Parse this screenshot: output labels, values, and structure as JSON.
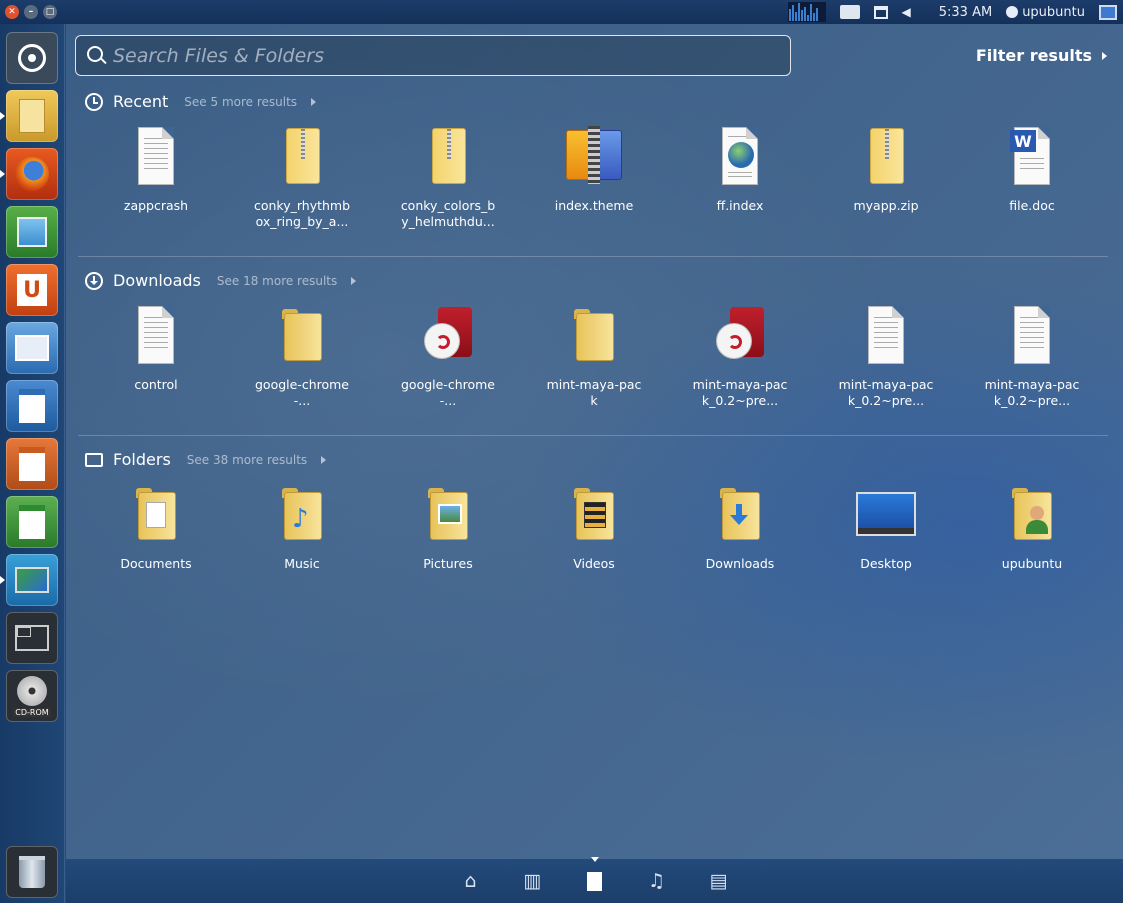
{
  "top_panel": {
    "time": "5:33 AM",
    "user": "upubuntu",
    "window_buttons": [
      "close-icon",
      "minimize-icon",
      "maximize-icon"
    ],
    "indicators": [
      "system-monitor-icon",
      "messaging-icon",
      "network-icon",
      "volume-icon",
      "user-icon",
      "display-icon"
    ]
  },
  "launcher": {
    "items": [
      {
        "name": "dash-home",
        "icon": "ubuntu-logo-icon"
      },
      {
        "name": "files",
        "icon": "folder-icon"
      },
      {
        "name": "firefox",
        "icon": "firefox-icon"
      },
      {
        "name": "shotwell",
        "icon": "photo-icon"
      },
      {
        "name": "ubuntu-software-center",
        "icon": "software-center-icon"
      },
      {
        "name": "system-settings",
        "icon": "settings-icon"
      },
      {
        "name": "libreoffice-writer",
        "icon": "writer-icon"
      },
      {
        "name": "libreoffice-impress",
        "icon": "impress-icon"
      },
      {
        "name": "libreoffice-calc",
        "icon": "calc-icon"
      },
      {
        "name": "remote-desktop",
        "icon": "remote-desktop-icon"
      },
      {
        "name": "workspace-switcher",
        "icon": "workspace-icon"
      },
      {
        "name": "cd-rom",
        "icon": "cd-rom-icon",
        "label": "CD-ROM"
      },
      {
        "name": "trash",
        "icon": "trash-icon"
      }
    ]
  },
  "search": {
    "placeholder": "Search Files & Folders",
    "value": ""
  },
  "filter": {
    "label": "Filter results"
  },
  "sections": {
    "recent": {
      "title": "Recent",
      "more": "See 5 more results",
      "items": [
        {
          "label": "zappcrash",
          "icon": "text-file-icon"
        },
        {
          "label": "conky_rhythmbox_ring_by_a...",
          "icon": "zip-archive-icon"
        },
        {
          "label": "conky_colors_by_helmuthdu...",
          "icon": "zip-archive-icon"
        },
        {
          "label": "index.theme",
          "icon": "theme-file-icon"
        },
        {
          "label": "ff.index",
          "icon": "web-document-icon"
        },
        {
          "label": "myapp.zip",
          "icon": "zip-archive-icon"
        },
        {
          "label": "file.doc",
          "icon": "word-document-icon"
        }
      ]
    },
    "downloads": {
      "title": "Downloads",
      "more": "See 18 more results",
      "items": [
        {
          "label": "control",
          "icon": "text-file-icon"
        },
        {
          "label": "google-chrome-...",
          "icon": "folder-icon"
        },
        {
          "label": "google-chrome-...",
          "icon": "debian-package-icon"
        },
        {
          "label": "mint-maya-pack",
          "icon": "folder-icon"
        },
        {
          "label": "mint-maya-pack_0.2~pre...",
          "icon": "debian-package-icon"
        },
        {
          "label": "mint-maya-pack_0.2~pre...",
          "icon": "text-file-icon"
        },
        {
          "label": "mint-maya-pack_0.2~pre...",
          "icon": "text-file-icon"
        }
      ]
    },
    "folders": {
      "title": "Folders",
      "more": "See 38 more results",
      "items": [
        {
          "label": "Documents",
          "icon": "documents-folder-icon"
        },
        {
          "label": "Music",
          "icon": "music-folder-icon"
        },
        {
          "label": "Pictures",
          "icon": "pictures-folder-icon"
        },
        {
          "label": "Videos",
          "icon": "videos-folder-icon"
        },
        {
          "label": "Downloads",
          "icon": "downloads-folder-icon"
        },
        {
          "label": "Desktop",
          "icon": "desktop-folder-icon"
        },
        {
          "label": "upubuntu",
          "icon": "home-folder-icon"
        }
      ]
    }
  },
  "lens_bar": {
    "lenses": [
      "home-lens-icon",
      "applications-lens-icon",
      "files-lens-icon",
      "music-lens-icon",
      "video-lens-icon"
    ],
    "active": "files-lens-icon"
  },
  "colors": {
    "panel": "#14305a",
    "launcher": "#1f4675",
    "dash_tint": "#4a6e9a",
    "close_button": "#e0522e"
  }
}
